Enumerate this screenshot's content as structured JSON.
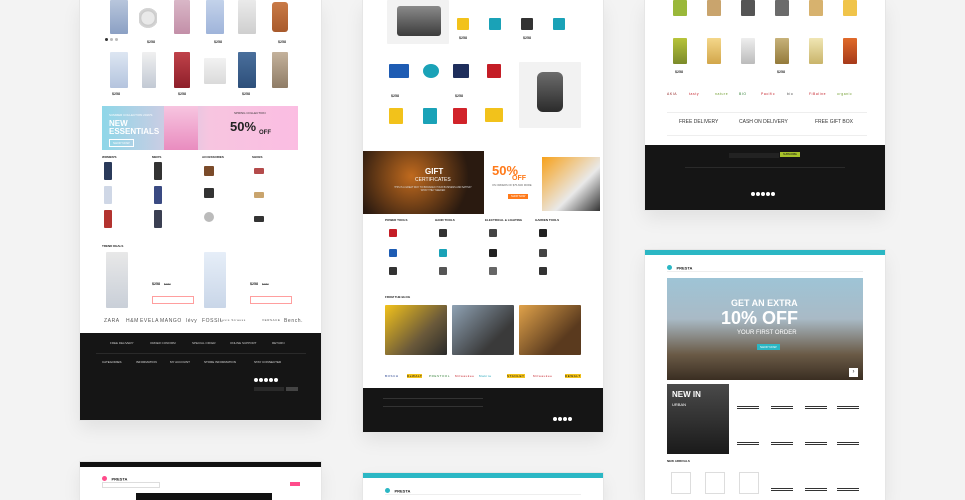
{
  "fashion": {
    "banner": {
      "eyebrow": "SUMMER COLLECTION 2016'S",
      "title_line1": "NEW",
      "title_line2": "ESSENTIALS",
      "button": "SHOP NOW",
      "promo_eyebrow": "SPRING COLLECTION",
      "promo_value": "50%",
      "promo_suffix": "OFF"
    },
    "categories": [
      "WOMEN'S",
      "MEN'S",
      "ACCESSORIES",
      "SHOES"
    ],
    "trend_heading": "TREND DEALS",
    "deal_price": "$258",
    "deal_old_price": "$287",
    "brands": [
      "ZARA",
      "H&M",
      "EVELA",
      "MANGO",
      "lévy",
      "FOSSIL",
      "Levis Strauss",
      "VERSACE",
      "Bench."
    ],
    "footer": {
      "features": [
        "FREE DELIVERY",
        "ORDER CONFIRM",
        "SPECIAL OFFER",
        "ONLINE SUPPORT",
        "RETURN"
      ],
      "columns": [
        "CATEGORIES",
        "INFORMATION",
        "MY ACCOUNT",
        "STORE INFORMATION",
        "STAY CONNECTED"
      ]
    },
    "price_sample": "$258"
  },
  "tools": {
    "banner": {
      "gift_title": "GIFT",
      "gift_sub": "CERTIFICATES",
      "gift_desc": "THIS IS A GREAT WAY TO BROADEN YOUR BUSINESS AND SATISFY WHAT THEY NEEDED",
      "promo_value": "50%",
      "promo_suffix": "OFF",
      "promo_desc": "ON ORDERS OF $75 AND MORE",
      "promo_button": "SHOP NOW"
    },
    "categories": [
      "POWER TOOLS",
      "HAND TOOLS",
      "ELECTRICAL & LIGHTING",
      "GARDEN TOOLS"
    ],
    "blog_heading": "FROM THE BLOG",
    "brands": [
      "BOSCH",
      "DeWALT",
      "PRESTOOL",
      "Milwaukee",
      "Makita",
      "STANLEY",
      "Milwaukee",
      "DEWALT"
    ],
    "price_sample": "$258"
  },
  "grocery": {
    "features": [
      "FREE DELIVERY",
      "CASH ON DELIVERY",
      "FREE GIFT BOX"
    ],
    "brands": [
      "AKIA",
      "tasty",
      "nature",
      "BIO",
      "Pacific",
      "bio",
      "FiBaline",
      "organic"
    ],
    "newsletter_button": "SUBSCRIBE",
    "price_sample": "$258"
  },
  "bikes": {
    "logo": "PRESTA",
    "hero": {
      "line1": "GET AN EXTRA",
      "line2": "10% OFF",
      "line3": "YOUR FIRST ORDER",
      "button": "SHOP NOW"
    },
    "promo_title": "NEW IN",
    "promo_sub": "URBAN",
    "arrivals_heading": "NEW ARRIVALS"
  },
  "bottom_cards": {
    "logo": "PRESTA"
  },
  "colors": {
    "accent_orange": "#ff7a1a",
    "accent_pink": "#ff4c8b",
    "accent_teal": "#2bb7c4",
    "accent_lime": "#a6c12a",
    "footer_dark": "#151515"
  }
}
